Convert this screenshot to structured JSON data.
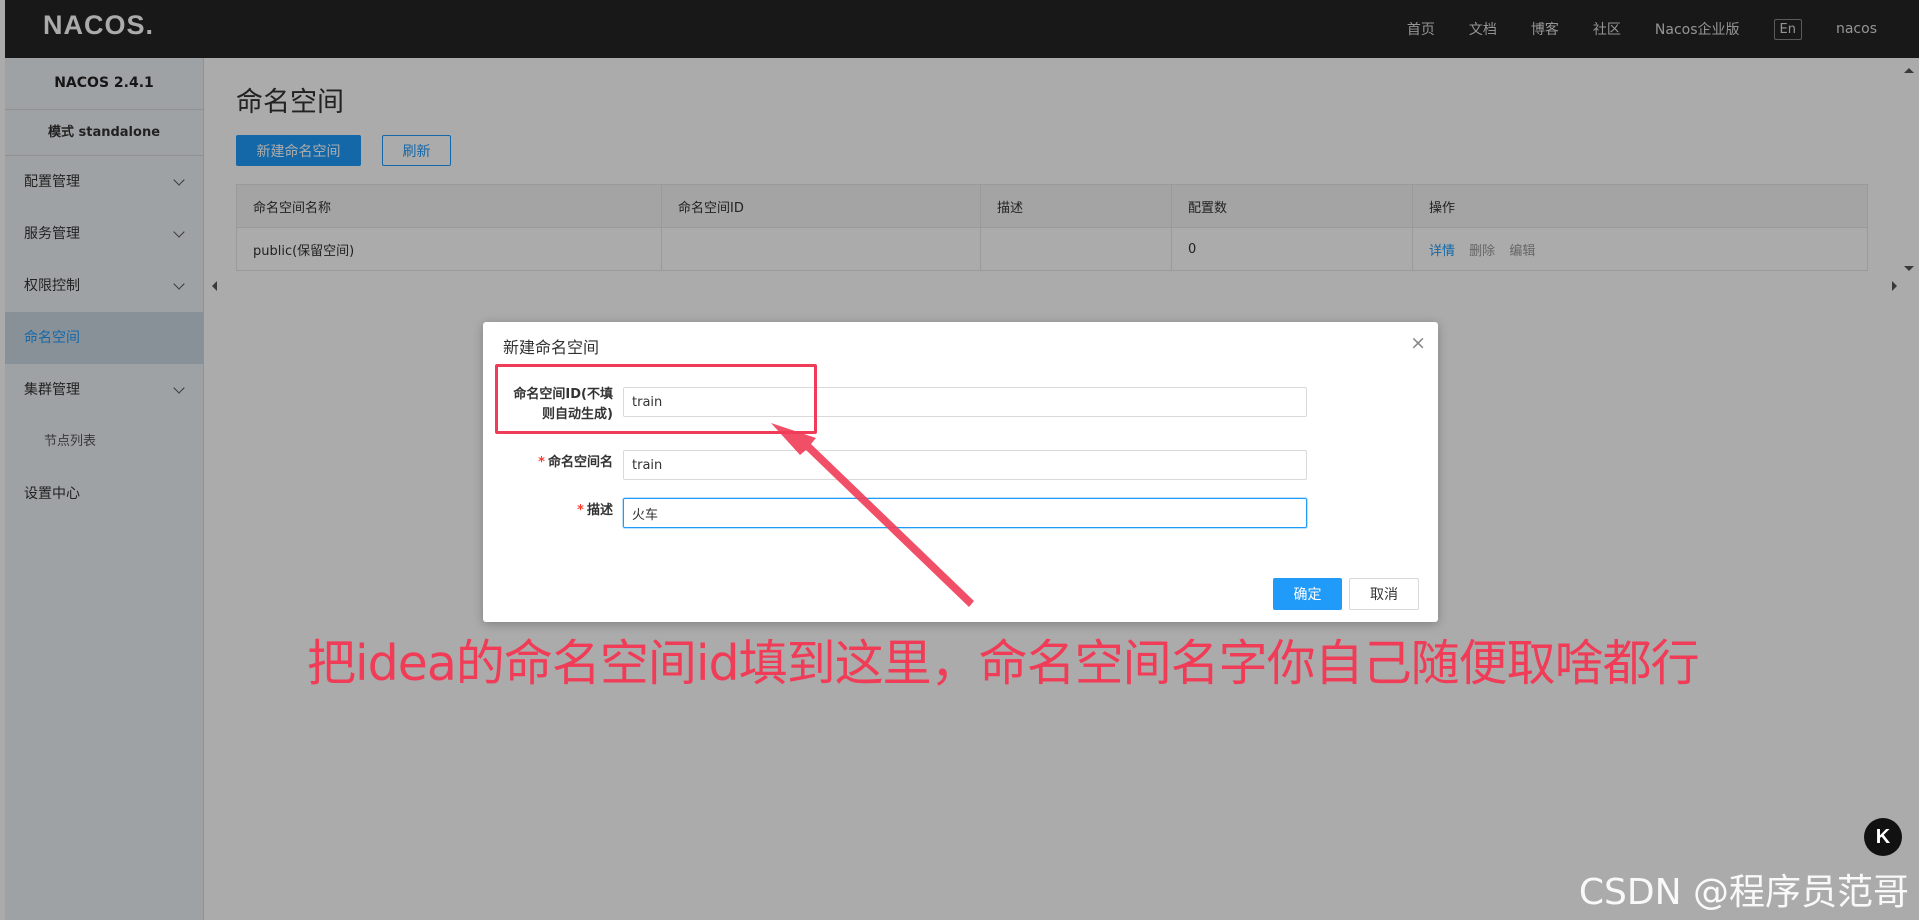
{
  "topbar": {
    "logo": "NACOS.",
    "nav": [
      "首页",
      "文档",
      "博客",
      "社区",
      "Nacos企业版"
    ],
    "lang_button": "En",
    "user": "nacos"
  },
  "sidebar": {
    "version": "NACOS 2.4.1",
    "mode": "模式 standalone",
    "items": [
      {
        "label": "配置管理",
        "expandable": true
      },
      {
        "label": "服务管理",
        "expandable": true
      },
      {
        "label": "权限控制",
        "expandable": true
      },
      {
        "label": "命名空间",
        "active": true
      },
      {
        "label": "集群管理",
        "expandable": true
      },
      {
        "label": "节点列表",
        "sub": true
      },
      {
        "label": "设置中心"
      }
    ]
  },
  "main": {
    "title": "命名空间",
    "new_button": "新建命名空间",
    "refresh_button": "刷新",
    "table": {
      "headers": [
        "命名空间名称",
        "命名空间ID",
        "描述",
        "配置数",
        "操作"
      ],
      "rows": [
        {
          "name": "public(保留空间)",
          "id": "",
          "desc": "",
          "count": "0",
          "ops": [
            "详情",
            "删除",
            "编辑"
          ]
        }
      ]
    }
  },
  "dialog": {
    "title": "新建命名空间",
    "close": "×",
    "id_label_line1": "命名空间ID(不填",
    "id_label_line2": "则自动生成)",
    "id_value": "train",
    "name_label": "命名空间名",
    "name_value": "train",
    "desc_label": "描述",
    "desc_value": "火车",
    "required_mark": "*",
    "ok": "确定",
    "cancel": "取消"
  },
  "annotation": "把idea的命名空间id填到这里，命名空间名字你自己随便取啥都行",
  "watermark": "CSDN @程序员范哥",
  "watermark_icon": "K",
  "colors": {
    "accent": "#209bfa",
    "annotation": "#f03c57",
    "topbar": "#242424",
    "sidebar": "#eef2f5"
  }
}
